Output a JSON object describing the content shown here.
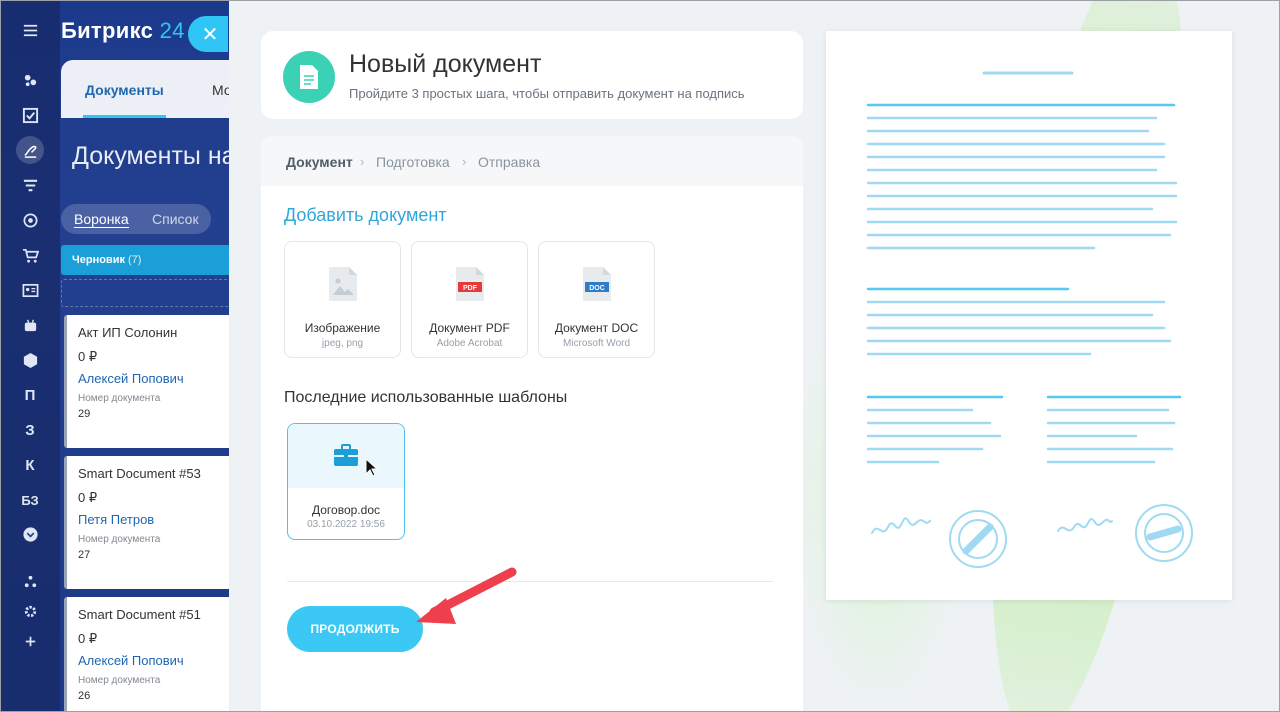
{
  "portal": {
    "logo_text": "Битрикс",
    "logo_num": "24",
    "tabs": [
      "Документы",
      "Мо"
    ],
    "title": "Документы на",
    "views": [
      "Воронка",
      "Список"
    ],
    "stage": {
      "name": "Черновик",
      "count": "(7)"
    },
    "nav_letters": [
      "П",
      "З",
      "К",
      "БЗ"
    ],
    "cards": [
      {
        "title": "Акт ИП Солонин",
        "sum": "0 ₽",
        "user": "Алексей Попович",
        "label": "Номер документа",
        "number": "29"
      },
      {
        "title": "Smart Document #53",
        "sum": "0 ₽",
        "user": "Петя Петров",
        "label": "Номер документа",
        "number": "27"
      },
      {
        "title": "Smart Document #51",
        "sum": "0 ₽",
        "user": "Алексей Попович",
        "label": "Номер документа",
        "number": "26"
      }
    ]
  },
  "header": {
    "title": "Новый документ",
    "subtitle": "Пройдите 3 простых шага, чтобы отправить документ на подпись"
  },
  "steps": [
    "Документ",
    "Подготовка",
    "Отправка"
  ],
  "add_document": {
    "title": "Добавить документ",
    "types": [
      {
        "name": "Изображение",
        "sub": "jpeg, png",
        "icon": "image-file-icon"
      },
      {
        "name": "Документ PDF",
        "sub": "Adobe Acrobat",
        "icon": "pdf-file-icon",
        "badge": "PDF"
      },
      {
        "name": "Документ DOC",
        "sub": "Microsoft Word",
        "icon": "doc-file-icon",
        "badge": "DOC"
      }
    ]
  },
  "recent": {
    "title": "Последние использованные шаблоны",
    "templates": [
      {
        "name": "Договор.doc",
        "date": "03.10.2022 19:56"
      }
    ]
  },
  "continue_label": "ПРОДОЛЖИТЬ",
  "colors": {
    "accent": "#2fc6f6",
    "header_icon": "#3ad1b4",
    "link": "#2067b0",
    "arrow": "#ee3f4c"
  }
}
